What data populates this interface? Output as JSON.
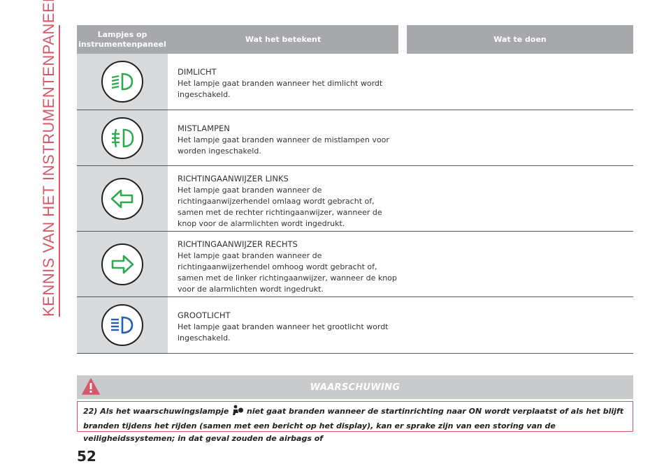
{
  "side_title": "KENNIS VAN HET INSTRUMENTENPANEEL",
  "table": {
    "headers": {
      "col1": "Lampjes op instrumentenpaneel",
      "col2": "Wat het betekent",
      "col3": "Wat te doen"
    },
    "rows": [
      {
        "icon": "low-beam-icon",
        "icon_color": "#2fa84f",
        "title": "DIMLICHT",
        "text": "Het lampje gaat branden wanneer het dimlicht wordt ingeschakeld."
      },
      {
        "icon": "fog-light-icon",
        "icon_color": "#2fa84f",
        "title": "MISTLAMPEN",
        "text": "Het lampje gaat branden wanneer de mistlampen voor worden ingeschakeld."
      },
      {
        "icon": "turn-left-arrow-icon",
        "icon_color": "#2fa84f",
        "title": "RICHTINGAANWIJZER LINKS",
        "text": "Het lampje gaat branden wanneer de richtingaanwijzerhendel omlaag wordt gebracht of, samen met de rechter richtingaanwijzer, wanneer de knop voor de alarmlichten wordt ingedrukt."
      },
      {
        "icon": "turn-right-arrow-icon",
        "icon_color": "#2fa84f",
        "title": "RICHTINGAANWIJZER RECHTS",
        "text": "Het lampje gaat branden wanneer de richtingaanwijzerhendel omhoog wordt gebracht of, samen met de linker richtingaanwijzer, wanneer de knop voor de alarmlichten wordt ingedrukt."
      },
      {
        "icon": "high-beam-icon",
        "icon_color": "#1f5fb4",
        "title": "GROOTLICHT",
        "text": "Het lampje gaat branden wanneer het grootlicht wordt ingeschakeld."
      }
    ]
  },
  "warning": {
    "title": "WAARSCHUWING",
    "icon": "warning-triangle-icon",
    "icon_color": "#d6596a",
    "number": "22)",
    "text_before_icon": "Als het waarschuwingslampje",
    "inline_icon": "airbag-icon",
    "text_after_icon": "niet gaat branden wanneer de startinrichting naar ON wordt verplaatst of als het blijft branden tijdens het rijden (samen met een bericht op het display), kan er sprake zijn van een storing van de veiligheidssystemen; in dat geval zouden de airbags of"
  },
  "page_number": "52",
  "colors": {
    "accent": "#d6596a",
    "header_gray": "#a6a8ab",
    "icon_cell_gray": "#d9dadb"
  }
}
